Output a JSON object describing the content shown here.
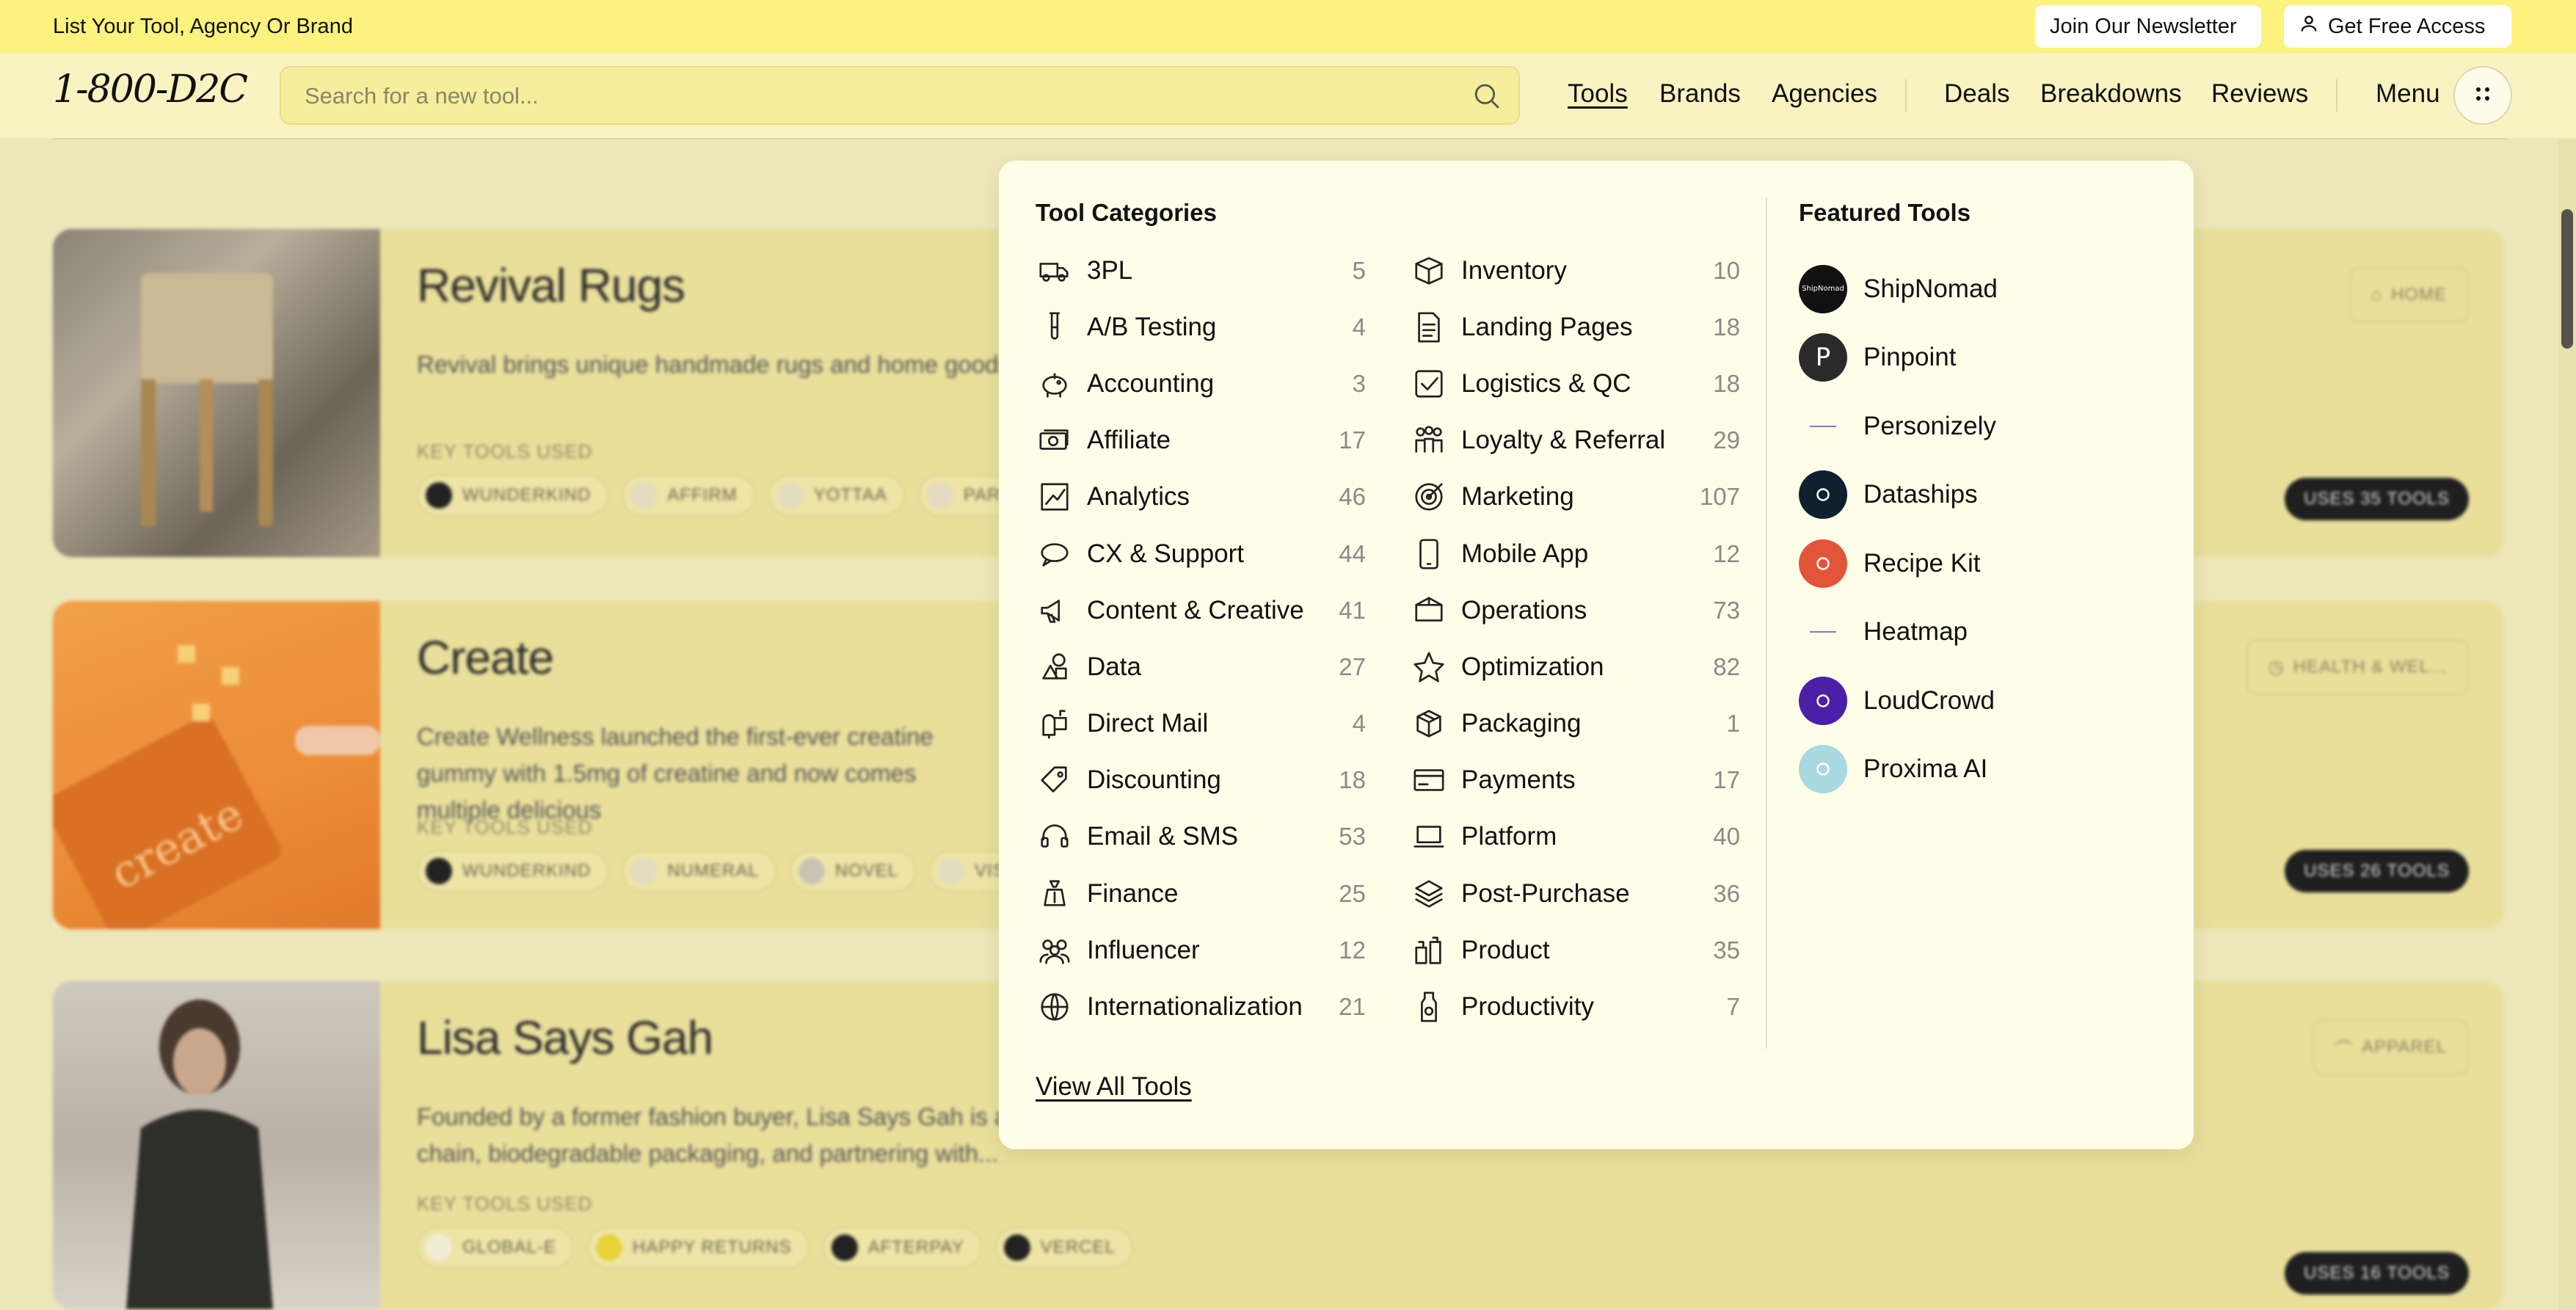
{
  "banner": {
    "promo": "List Your Tool, Agency Or Brand",
    "newsletter": "Join Our Newsletter",
    "access": "Get Free Access"
  },
  "header": {
    "logo": "1-800-D2C",
    "search_placeholder": "Search for a new tool...",
    "nav": [
      {
        "label": "Tools",
        "active": true
      },
      {
        "label": "Brands"
      },
      {
        "label": "Agencies"
      },
      {
        "label": "Deals"
      },
      {
        "label": "Breakdowns"
      },
      {
        "label": "Reviews"
      }
    ],
    "menu": "Menu"
  },
  "dropdown": {
    "categories_title": "Tool Categories",
    "featured_title": "Featured Tools",
    "view_all": "View All Tools",
    "categories_left": [
      {
        "label": "3PL",
        "count": "5",
        "icon": "truck-icon"
      },
      {
        "label": "A/B Testing",
        "count": "4",
        "icon": "test-tube-icon"
      },
      {
        "label": "Accounting",
        "count": "3",
        "icon": "piggy-bank-icon"
      },
      {
        "label": "Affiliate",
        "count": "17",
        "icon": "money-icon"
      },
      {
        "label": "Analytics",
        "count": "46",
        "icon": "chart-icon"
      },
      {
        "label": "CX & Support",
        "count": "44",
        "icon": "chat-bubble-icon"
      },
      {
        "label": "Content & Creative",
        "count": "41",
        "icon": "megaphone-icon"
      },
      {
        "label": "Data",
        "count": "27",
        "icon": "shapes-icon"
      },
      {
        "label": "Direct Mail",
        "count": "4",
        "icon": "mailbox-icon"
      },
      {
        "label": "Discounting",
        "count": "18",
        "icon": "tag-icon"
      },
      {
        "label": "Email & SMS",
        "count": "53",
        "icon": "headset-icon"
      },
      {
        "label": "Finance",
        "count": "25",
        "icon": "money-bag-icon"
      },
      {
        "label": "Influencer",
        "count": "12",
        "icon": "people-icon"
      },
      {
        "label": "Internationalization",
        "count": "21",
        "icon": "globe-icon"
      }
    ],
    "categories_right": [
      {
        "label": "Inventory",
        "count": "10",
        "icon": "box-icon"
      },
      {
        "label": "Landing Pages",
        "count": "18",
        "icon": "document-icon"
      },
      {
        "label": "Logistics & QC",
        "count": "18",
        "icon": "checkbox-icon"
      },
      {
        "label": "Loyalty & Referral",
        "count": "29",
        "icon": "group-icon"
      },
      {
        "label": "Marketing",
        "count": "107",
        "icon": "target-icon"
      },
      {
        "label": "Mobile App",
        "count": "12",
        "icon": "phone-icon"
      },
      {
        "label": "Operations",
        "count": "73",
        "icon": "package-icon"
      },
      {
        "label": "Optimization",
        "count": "82",
        "icon": "star-icon"
      },
      {
        "label": "Packaging",
        "count": "1",
        "icon": "cube-icon"
      },
      {
        "label": "Payments",
        "count": "17",
        "icon": "credit-card-icon"
      },
      {
        "label": "Platform",
        "count": "40",
        "icon": "laptop-icon"
      },
      {
        "label": "Post-Purchase",
        "count": "36",
        "icon": "layers-icon"
      },
      {
        "label": "Product",
        "count": "35",
        "icon": "products-icon"
      },
      {
        "label": "Productivity",
        "count": "7",
        "icon": "bottle-icon"
      }
    ],
    "featured": [
      {
        "label": "ShipNomad",
        "logo_text": "ShipNomad",
        "color": "#111111"
      },
      {
        "label": "Pinpoint",
        "logo_text": "P",
        "color": "#2a2a2a"
      },
      {
        "label": "Personizely",
        "logo_text": "",
        "color": "#fefde8"
      },
      {
        "label": "Dataships",
        "logo_text": "",
        "color": "#10202e"
      },
      {
        "label": "Recipe Kit",
        "logo_text": "",
        "color": "#e2553a"
      },
      {
        "label": "Heatmap",
        "logo_text": "",
        "color": "#fefde8"
      },
      {
        "label": "LoudCrowd",
        "logo_text": "",
        "color": "#4b1fa8"
      },
      {
        "label": "Proxima AI",
        "logo_text": "",
        "color": "#a8d8e0"
      }
    ]
  },
  "background": {
    "cards": [
      {
        "title": "Revival Rugs",
        "desc": "Revival brings unique handmade rugs and home goods",
        "key_tools_label": "KEY TOOLS USED",
        "tools": [
          "WUNDERKIND",
          "AFFIRM",
          "YOTTAA",
          "PARK"
        ],
        "badge": "HOME",
        "uses": "USES 35 TOOLS"
      },
      {
        "title": "Create",
        "desc": "Create Wellness launched the first-ever creatine gummy with 1.5mg of creatine and now comes multiple delicious",
        "key_tools_label": "KEY TOOLS USED",
        "tools": [
          "WUNDERKIND",
          "NUMERAL",
          "NOVEL",
          "VISU"
        ],
        "badge": "HEALTH & WEL...",
        "uses": "USES 26 TOOLS"
      },
      {
        "title": "Lisa Says Gah",
        "desc": "Founded by a former fashion buyer, Lisa Says Gah is at hyperaware of its carbon footprint and makes every effort to reduce waste throughout its supply chain, biodegradable packaging, and partnering with...",
        "key_tools_label": "KEY TOOLS USED",
        "tools": [
          "GLOBAL-E",
          "HAPPY RETURNS",
          "AFTERPAY",
          "VERCEL"
        ],
        "badge": "APPAREL",
        "uses": "USES 16 TOOLS"
      }
    ]
  }
}
